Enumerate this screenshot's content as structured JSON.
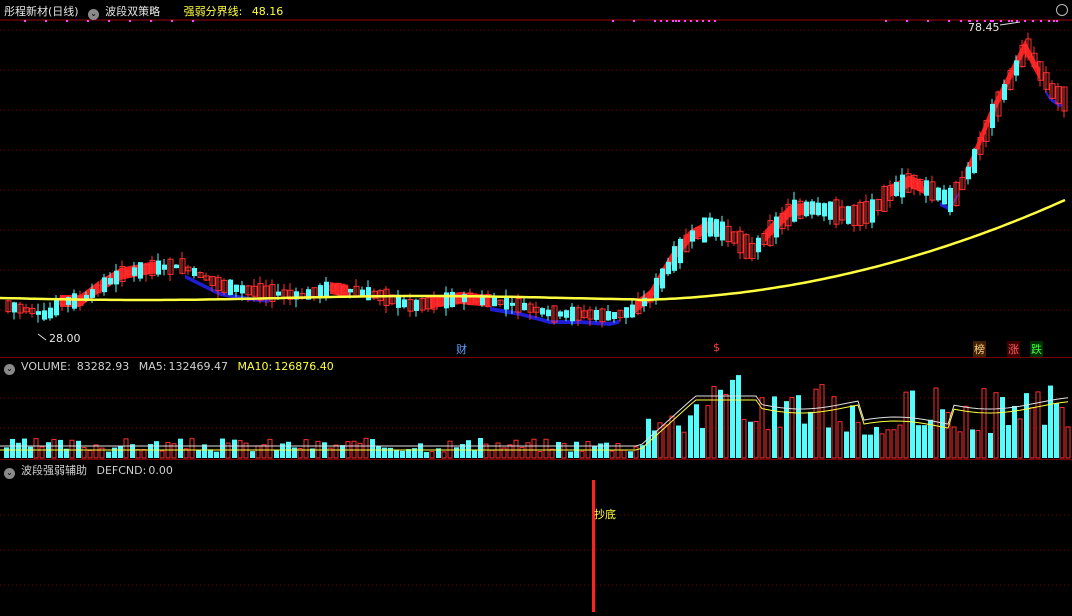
{
  "main": {
    "title": "彤程新材(日线)",
    "strategy": "波段双策略",
    "boundary_label": "强弱分界线:",
    "boundary_value": "48.16",
    "high_label": "78.45",
    "low_label": "28.00",
    "events": [
      {
        "label": "财",
        "color": "#60a0ff"
      },
      {
        "label": "$",
        "color": "#ff4040"
      },
      {
        "label": "榜",
        "color": "#ffd080"
      },
      {
        "label": "涨",
        "color": "#ff6060"
      },
      {
        "label": "跌",
        "color": "#40ff40"
      }
    ]
  },
  "volume": {
    "label": "VOLUME:",
    "value": "83282.93",
    "ma5_label": "MA5:",
    "ma5_value": "132469.47",
    "ma10_label": "MA10:",
    "ma10_value": "126876.40"
  },
  "aux": {
    "title": "波段强弱辅助",
    "defcnd_label": "DEFCND:",
    "defcnd_value": "0.00",
    "signal_label": "抄底"
  },
  "colors": {
    "up": "#ff3030",
    "down": "#54fcfc",
    "yellow_line": "#ffff40",
    "fill_up": "#ff2020",
    "fill_down": "#2020e0",
    "grid": "#7a0000"
  }
}
